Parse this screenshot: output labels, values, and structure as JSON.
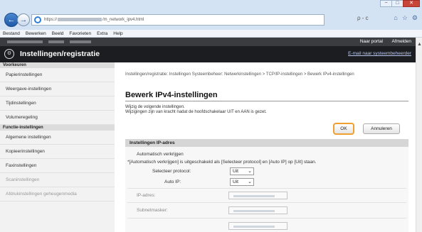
{
  "browser": {
    "url_start": "https://",
    "url_end": "/m_network_ipv4.html",
    "search_glyph": "ρ - c",
    "icons": [
      "home-icon",
      "star-icon",
      "gear-icon"
    ],
    "window_controls": [
      "−",
      "□",
      "✕"
    ]
  },
  "menu": [
    "Bestand",
    "Bewerken",
    "Beeld",
    "Favorieten",
    "Extra",
    "Help"
  ],
  "header": {
    "portal_link": "Naar portal",
    "logout_link": "Afmelden",
    "app_title": "Instellingen/registratie",
    "email_link": "E-mail naar systeembeheerder"
  },
  "sidebar": {
    "section1": "Voorkeuren",
    "items1": [
      "Papierinstellingen",
      "Weergave-instellingen",
      "Tijdinstellingen",
      "Volumeregeling"
    ],
    "section2": "Functie-instellingen",
    "items2": [
      "Algemene instellingen",
      "Kopieerinstellingen",
      "Faxinstellingen",
      "Scaninstellingen",
      "Afdrukinstellingen geheugenmedia"
    ]
  },
  "main": {
    "breadcrumb": "Instellingen/registratie: Instellingen Systeembeheer: Netwerkinstellingen > TCP/IP-instellingen > Bewerk IPv4-instellingen",
    "title": "Bewerk IPv4-instellingen",
    "instruction1": "Wijzig de volgende instellingen.",
    "instruction2": "Wijzigingen zijn van kracht nadat de hoofdschakelaar UIT en AAN is gezet.",
    "ok_label": "OK",
    "cancel_label": "Annuleren",
    "panel_title": "Instellingen IP-adres",
    "auto_label": "Automatisch verkrijgen",
    "note": "*[Automatisch verkrijgen] is uitgeschakeld als [Selecteer protocol] en [Auto IP] op [Uit] staan.",
    "select_protocol_label": "Selecteer protocol:",
    "select_protocol_value": "Uit",
    "auto_ip_label": "Auto IP:",
    "auto_ip_value": "Uit",
    "ip_label": "IP-adres:",
    "subnet_label": "Subnetmasker:"
  },
  "colors": {
    "header_dark": "#1c1d20",
    "ok_highlight": "#f0a030",
    "link": "#b9c8ef"
  }
}
